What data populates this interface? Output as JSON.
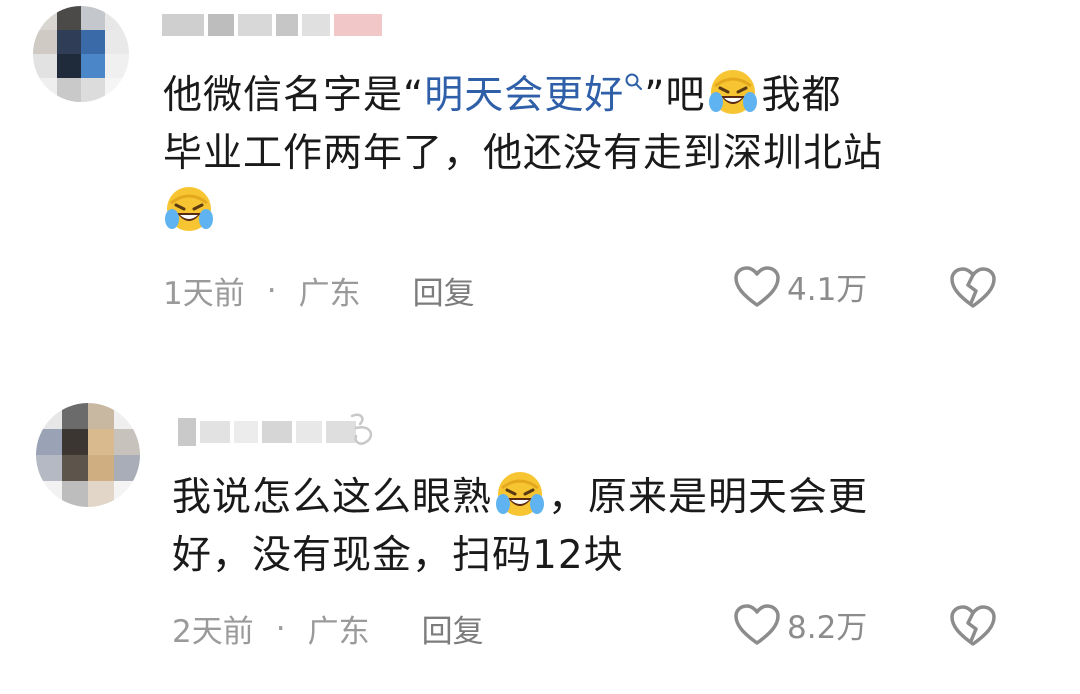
{
  "comments": [
    {
      "text_before_link": "他微信名字是“",
      "link_text": "明天会更好",
      "text_after_link": "”吧",
      "text_after_emoji_1": "我都",
      "line2": "毕业工作两年了，他还没有走到深圳北站",
      "time": "1天前",
      "location": "广东",
      "reply_label": "回复",
      "like_count": "4.1万"
    },
    {
      "line1_before_emoji": "我说怎么这么眼熟",
      "line1_after_emoji": "，原来是明天会更",
      "line2": "好，没有现金，扫码12块",
      "time": "2天前",
      "location": "广东",
      "reply_label": "回复",
      "like_count": "8.2万"
    }
  ],
  "separator": "·",
  "icons": {
    "link_search": "magnifier-icon",
    "emoji": "laughing-crying-emoji",
    "like": "heart-outline-icon",
    "dislike": "broken-heart-icon",
    "badge": "verify-badge-icon"
  },
  "colors": {
    "text": "#1a1a1a",
    "link": "#2e5fa8",
    "meta": "#9a9a9a"
  }
}
